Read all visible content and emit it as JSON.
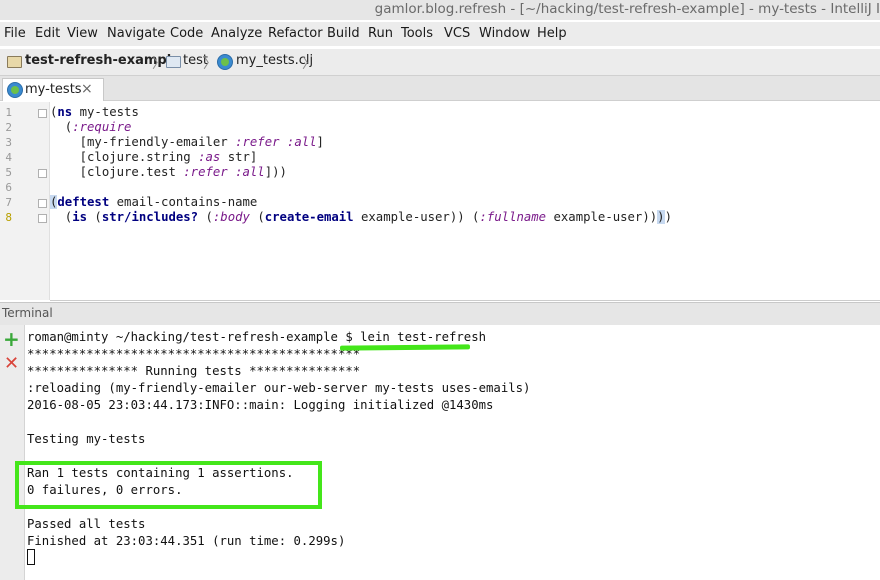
{
  "window": {
    "title": "gamlor.blog.refresh - [~/hacking/test-refresh-example] - my-tests - IntelliJ I"
  },
  "menu": [
    "File",
    "Edit",
    "View",
    "Navigate",
    "Code",
    "Analyze",
    "Refactor",
    "Build",
    "Run",
    "Tools",
    "VCS",
    "Window",
    "Help"
  ],
  "breadcrumb": {
    "project": "test-refresh-example",
    "folder": "test",
    "file": "my_tests.clj"
  },
  "tabs": [
    {
      "label": "my-tests",
      "close": "×"
    }
  ],
  "editor": {
    "line_numbers": [
      "1",
      "2",
      "3",
      "4",
      "5",
      "6",
      "7",
      "8"
    ]
  },
  "terminal": {
    "header": "Terminal",
    "lines": [
      "roman@minty ~/hacking/test-refresh-example $ lein test-refresh",
      "*********************************************",
      "*************** Running tests ***************",
      ":reloading (my-friendly-emailer our-web-server my-tests uses-emails)",
      "2016-08-05 23:03:44.173:INFO::main: Logging initialized @1430ms",
      "",
      "Testing my-tests",
      "",
      "Ran 1 tests containing 1 assertions.",
      "0 failures, 0 errors.",
      "",
      "Passed all tests",
      "Finished at 23:03:44.351 (run time: 0.299s)"
    ]
  },
  "icons": {
    "add": "plus-icon",
    "close": "close-icon"
  },
  "colors": {
    "highlight": "#44e61a",
    "keyword": "#000080",
    "clojure_keyword": "#7a1a8a"
  }
}
